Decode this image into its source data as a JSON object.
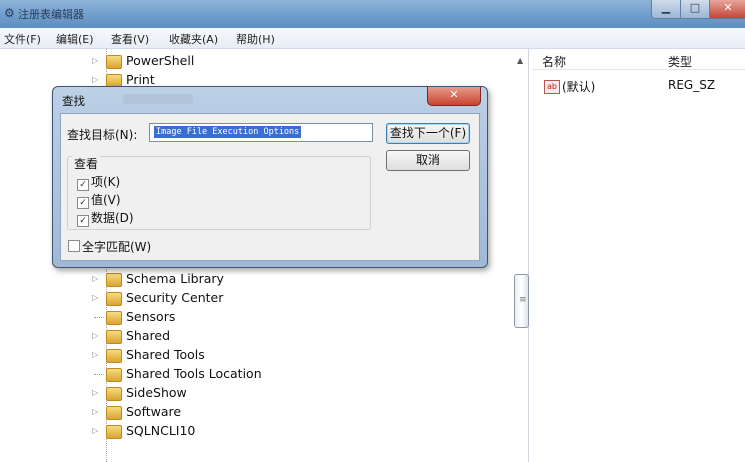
{
  "window": {
    "title": "注册表编辑器"
  },
  "menu": [
    "文件(F)",
    "编辑(E)",
    "查看(V)",
    "收藏夹(A)",
    "帮助(H)"
  ],
  "tree": {
    "top_items": [
      "PowerShell",
      "Print"
    ],
    "items": [
      {
        "label": "Schema Library",
        "expandable": true
      },
      {
        "label": "Security Center",
        "expandable": true
      },
      {
        "label": "Sensors",
        "expandable": false
      },
      {
        "label": "Shared",
        "expandable": true
      },
      {
        "label": "Shared Tools",
        "expandable": true
      },
      {
        "label": "Shared Tools Location",
        "expandable": false
      },
      {
        "label": "SideShow",
        "expandable": true
      },
      {
        "label": "Software",
        "expandable": true
      },
      {
        "label": "SQLNCLI10",
        "expandable": true
      }
    ]
  },
  "list": {
    "columns": [
      "名称",
      "类型"
    ],
    "rows": [
      {
        "name": "(默认)",
        "type": "REG_SZ",
        "icon": "ab-string-icon"
      }
    ]
  },
  "dialog": {
    "title": "查找",
    "find_label": "查找目标(N):",
    "find_value": "Image File Execution Options",
    "find_next": "查找下一个(F)",
    "cancel": "取消",
    "look_at": "查看",
    "checkboxes": [
      {
        "label": "项(K)",
        "checked": true
      },
      {
        "label": "值(V)",
        "checked": true
      },
      {
        "label": "数据(D)",
        "checked": true
      }
    ],
    "whole_string": {
      "label": "全字匹配(W)",
      "checked": false
    }
  }
}
